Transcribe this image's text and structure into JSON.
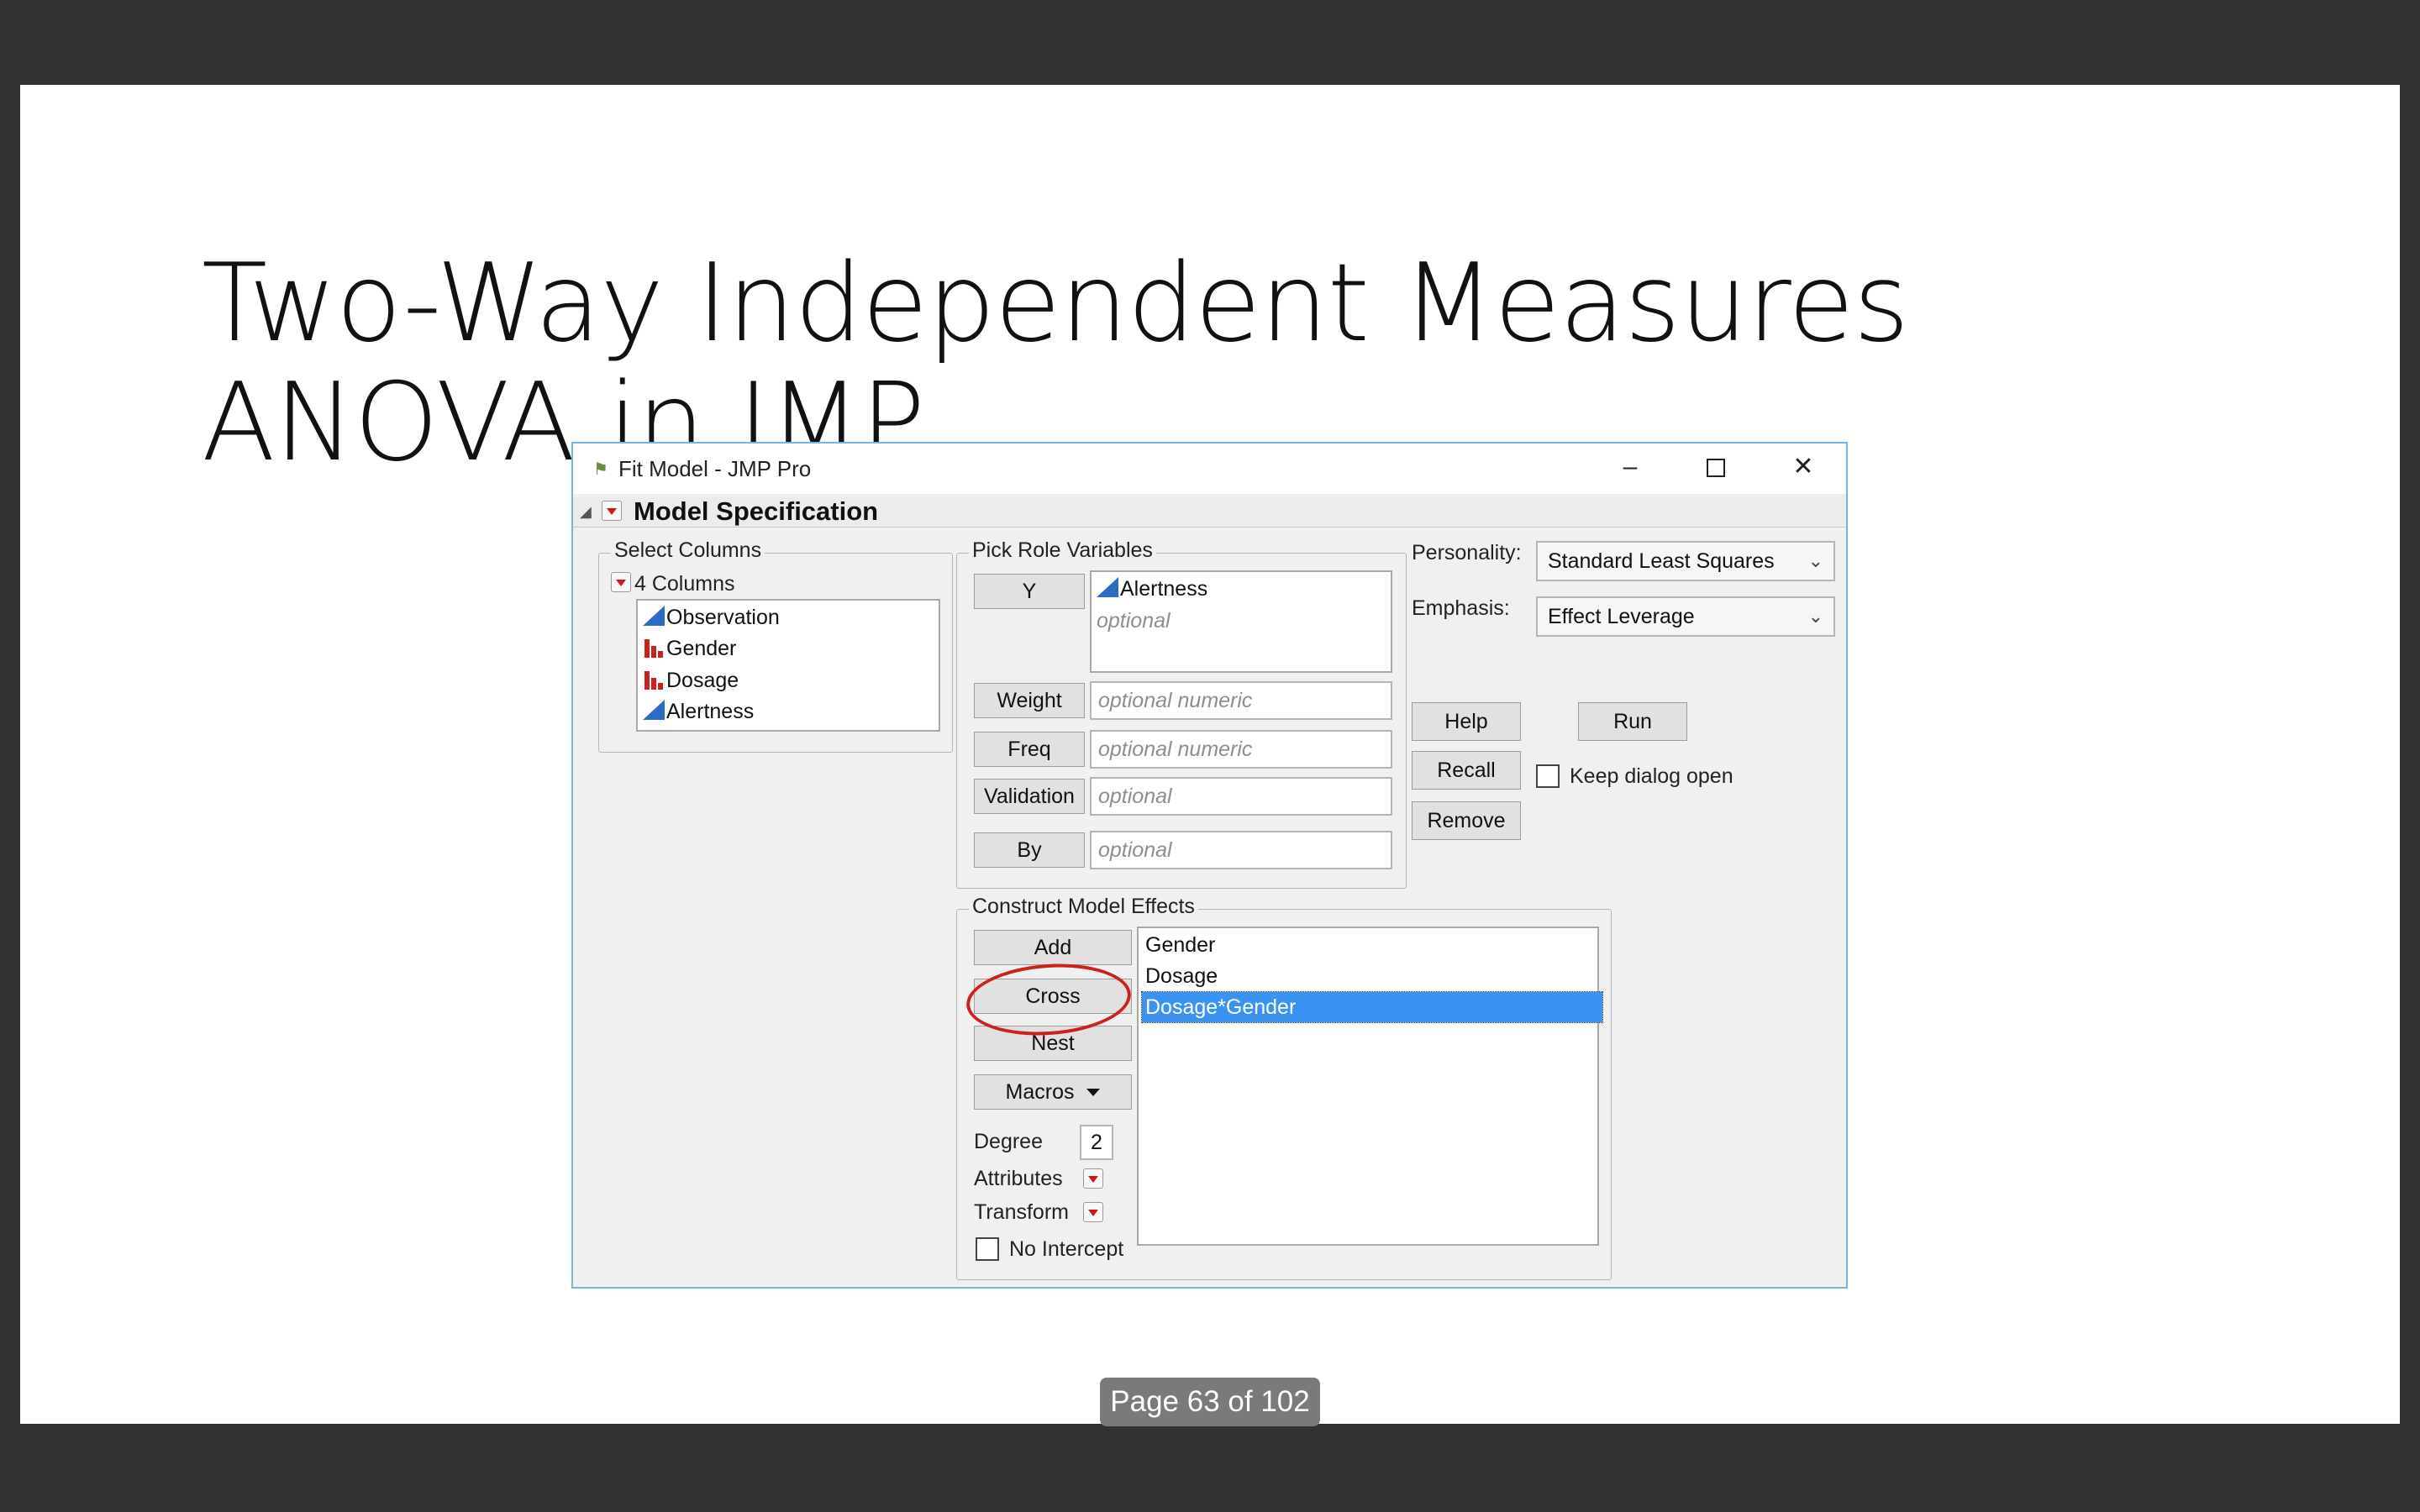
{
  "slide": {
    "title_line1": "Two-Way Independent Measures",
    "title_line2": "ANOVA in JMP"
  },
  "window": {
    "title": "Fit Model - JMP Pro",
    "min_glyph": "–",
    "close_glyph": "✕"
  },
  "model_spec": {
    "title": "Model Specification"
  },
  "select_columns": {
    "label": "Select Columns",
    "count_label": "4 Columns",
    "items": [
      {
        "label": "Observation",
        "type": "continuous"
      },
      {
        "label": "Gender",
        "type": "nominal"
      },
      {
        "label": "Dosage",
        "type": "nominal"
      },
      {
        "label": "Alertness",
        "type": "continuous"
      }
    ]
  },
  "pick_roles": {
    "label": "Pick Role Variables",
    "y_button": "Y",
    "y_value": "Alertness",
    "y_placeholder": "optional",
    "weight_button": "Weight",
    "weight_placeholder": "optional numeric",
    "freq_button": "Freq",
    "freq_placeholder": "optional numeric",
    "validation_button": "Validation",
    "validation_placeholder": "optional",
    "by_button": "By",
    "by_placeholder": "optional"
  },
  "options": {
    "personality_label": "Personality:",
    "personality_value": "Standard Least Squares",
    "emphasis_label": "Emphasis:",
    "emphasis_value": "Effect Leverage",
    "help_button": "Help",
    "run_button": "Run",
    "recall_button": "Recall",
    "keep_open_label": "Keep dialog open",
    "keep_open_checked": false,
    "remove_button": "Remove",
    "chevron_icon": "chevron-down-icon"
  },
  "construct": {
    "label": "Construct Model Effects",
    "add_button": "Add",
    "cross_button": "Cross",
    "nest_button": "Nest",
    "macros_button": "Macros",
    "degree_label": "Degree",
    "degree_value": "2",
    "attributes_label": "Attributes",
    "transform_label": "Transform",
    "no_intercept_label": "No Intercept",
    "no_intercept_checked": false,
    "effects": [
      "Gender",
      "Dosage",
      "Dosage*Gender"
    ],
    "selected_effect": "Dosage*Gender"
  },
  "annotation": {
    "circle_color": "#cf2020"
  },
  "footer": {
    "page_indicator": "Page 63 of 102"
  },
  "colors": {
    "selection": "#3a93f0",
    "continuous_icon": "#2e6bc4",
    "nominal_icon": "#cc2020",
    "window_border": "#79b4e0"
  }
}
